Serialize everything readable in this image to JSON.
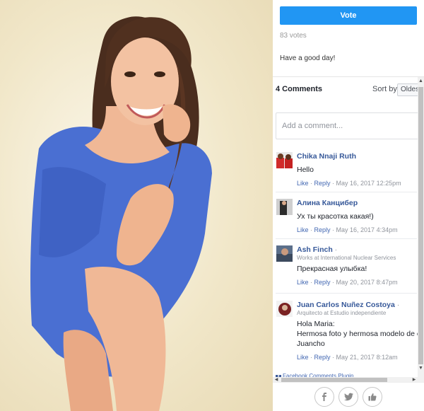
{
  "vote": {
    "label": "Vote",
    "count_text": "83 votes"
  },
  "caption": "Have a good day!",
  "comments_section": {
    "count_label": "4 Comments",
    "sort_label": "Sort by",
    "sort_value": "Oldest",
    "input_placeholder": "Add a comment...",
    "plugin_label": "Facebook Comments Plugin",
    "comments": [
      {
        "name": "Chika Nnaji Ruth",
        "subtitle": "",
        "text": [
          "Hello"
        ],
        "like": "Like",
        "reply": "Reply",
        "date": "May 16, 2017 12:25pm"
      },
      {
        "name": "Алина Канцибер",
        "subtitle": "",
        "text": [
          "Ух ты красотка какая!)"
        ],
        "like": "Like",
        "reply": "Reply",
        "date": "May 16, 2017 4:34pm"
      },
      {
        "name": "Ash Finch",
        "subtitle": "Works at International Nuclear Services",
        "text": [
          "Прекрасная улыбка!"
        ],
        "like": "Like",
        "reply": "Reply",
        "date": "May 20, 2017 8:47pm"
      },
      {
        "name": "Juan Carlos Nuñez Costoya",
        "subtitle": "Arquitecto at Estudio independiente",
        "text": [
          "Hola Maria:",
          "Hermosa foto y hermosa modelo de c",
          "Juancho"
        ],
        "like": "Like",
        "reply": "Reply",
        "date": "May 21, 2017 8:12am"
      }
    ]
  },
  "colors": {
    "vote_button": "#2196f3",
    "link_blue": "#365899",
    "meta_gray": "#90949c"
  },
  "share_icons": [
    "facebook-icon",
    "twitter-icon",
    "like-icon"
  ]
}
